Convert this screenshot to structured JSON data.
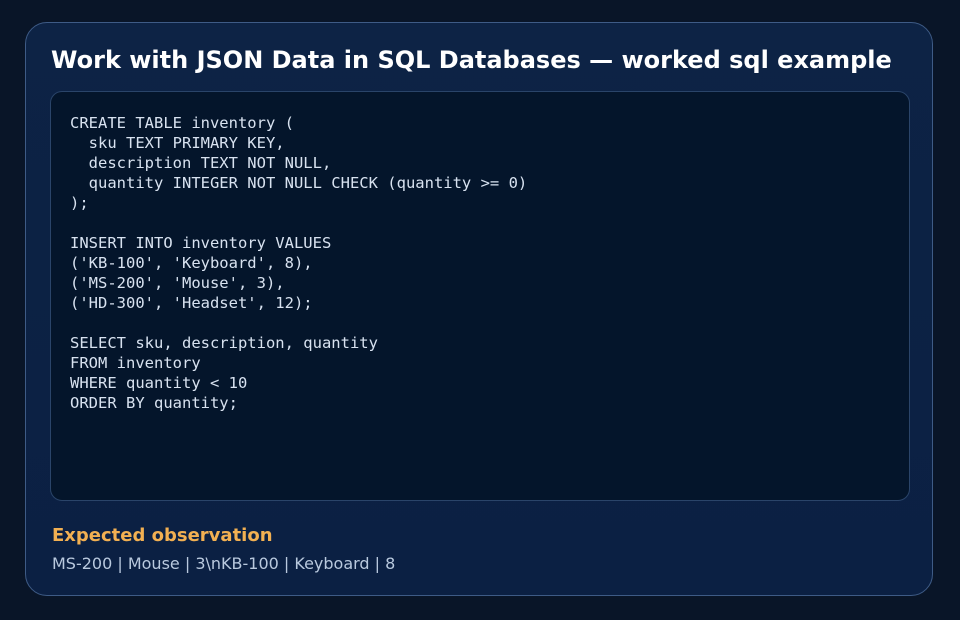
{
  "card": {
    "title": "Work with JSON Data in SQL Databases — worked sql example",
    "code": "CREATE TABLE inventory (\n  sku TEXT PRIMARY KEY,\n  description TEXT NOT NULL,\n  quantity INTEGER NOT NULL CHECK (quantity >= 0)\n);\n\nINSERT INTO inventory VALUES\n('KB-100', 'Keyboard', 8),\n('MS-200', 'Mouse', 3),\n('HD-300', 'Headset', 12);\n\nSELECT sku, description, quantity\nFROM inventory\nWHERE quantity < 10\nORDER BY quantity;",
    "observation_label": "Expected observation",
    "observation_value": "MS-200 | Mouse | 3\\nKB-100 | Keyboard | 8"
  },
  "colors": {
    "background": "#091528",
    "card": "#0d2345",
    "card_border": "#3e5b86",
    "code_panel": "#04152b",
    "title": "#ffffff",
    "code_text": "#d8e2f0",
    "accent": "#f2b052",
    "observation_text": "#b9c9de"
  }
}
